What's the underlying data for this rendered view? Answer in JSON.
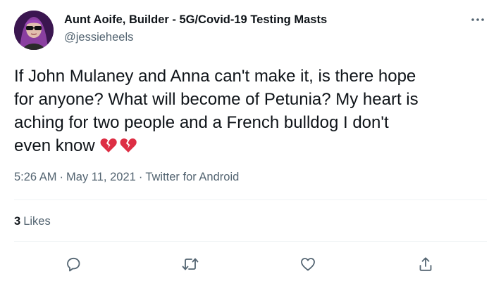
{
  "author": {
    "name": "Aunt Aoife, Builder - 5G/Covid-19 Testing Masts",
    "handle": "@jessieheels"
  },
  "tweet": {
    "lines": [
      "If John Mulaney and Anna can't make it, is there hope",
      "for anyone? What will become of Petunia? My heart is",
      "aching for two people and a French bulldog I don't",
      "even know"
    ],
    "emoji": [
      "broken-heart",
      "broken-heart"
    ]
  },
  "meta": {
    "time": "5:26 AM",
    "separator": "·",
    "date": "May 11, 2021",
    "source": "Twitter for Android"
  },
  "engagement": {
    "likes_count": "3",
    "likes_label": "Likes"
  },
  "actions": [
    "reply-icon",
    "retweet-icon",
    "like-icon",
    "share-icon"
  ],
  "colors": {
    "text": "#0f1419",
    "secondary": "#536471",
    "divider": "#eff3f4",
    "emoji": "#dd2e44"
  }
}
